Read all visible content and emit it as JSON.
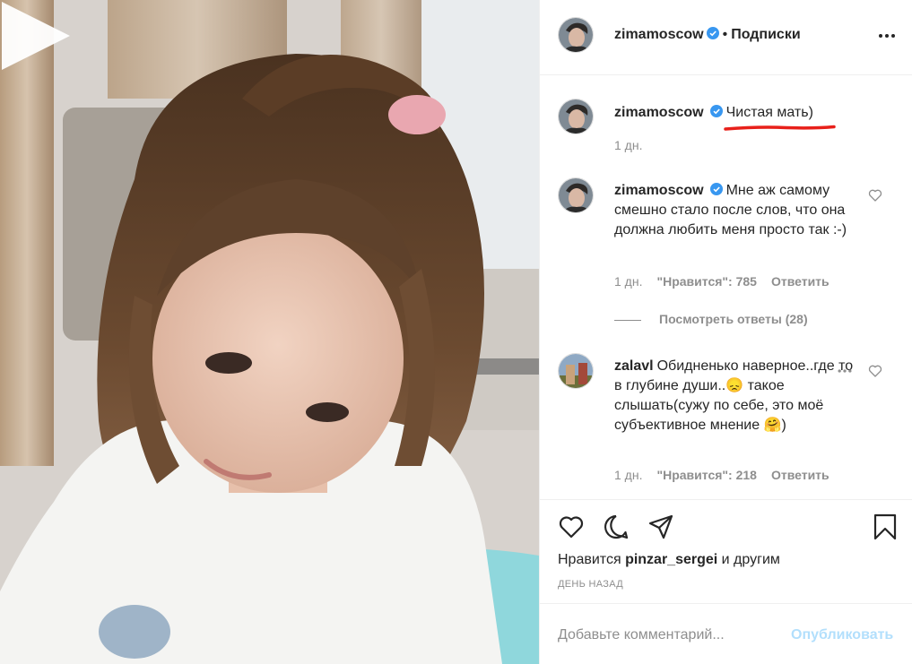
{
  "header": {
    "username": "zimamoscow",
    "separator": "•",
    "follow_label": "Подписки"
  },
  "caption": {
    "username": "zimamoscow",
    "text": "Чистая мать)",
    "time": "1 дн."
  },
  "comments": [
    {
      "username": "zimamoscow",
      "text": "Мне аж самому смешно стало после слов, что она должна любить меня просто так :-)",
      "time": "1 дн.",
      "likes": "\"Нравится\": 785",
      "reply_label": "Ответить",
      "view_replies": "Посмотреть ответы (28)"
    },
    {
      "username": "zalavl",
      "text_part1": "Обидненько наверное..где то в глубине души..",
      "emoji1": "😞",
      "text_part2": " такое слышать(сужу по себе, это моё субъективное мнение ",
      "emoji2": "🤗",
      "text_part3": ")",
      "time": "1 дн.",
      "likes": "\"Нравится\": 218",
      "reply_label": "Ответить"
    }
  ],
  "likes": {
    "prefix": "Нравится",
    "user": "pinzar_sergei",
    "suffix": "и другим"
  },
  "time_ago": "ДЕНЬ НАЗАД",
  "comment_box": {
    "placeholder": "Добавьте комментарий...",
    "publish_label": "Опубликовать"
  },
  "icons": [
    "play-icon",
    "more-icon",
    "verified-badge-icon",
    "heart-icon",
    "comment-icon",
    "share-icon",
    "bookmark-icon"
  ],
  "colors": {
    "verified_blue": "#3897f0",
    "muted": "#8e8e8e",
    "publish_disabled": "#b2dffc",
    "annotation_red": "#e8201a"
  }
}
